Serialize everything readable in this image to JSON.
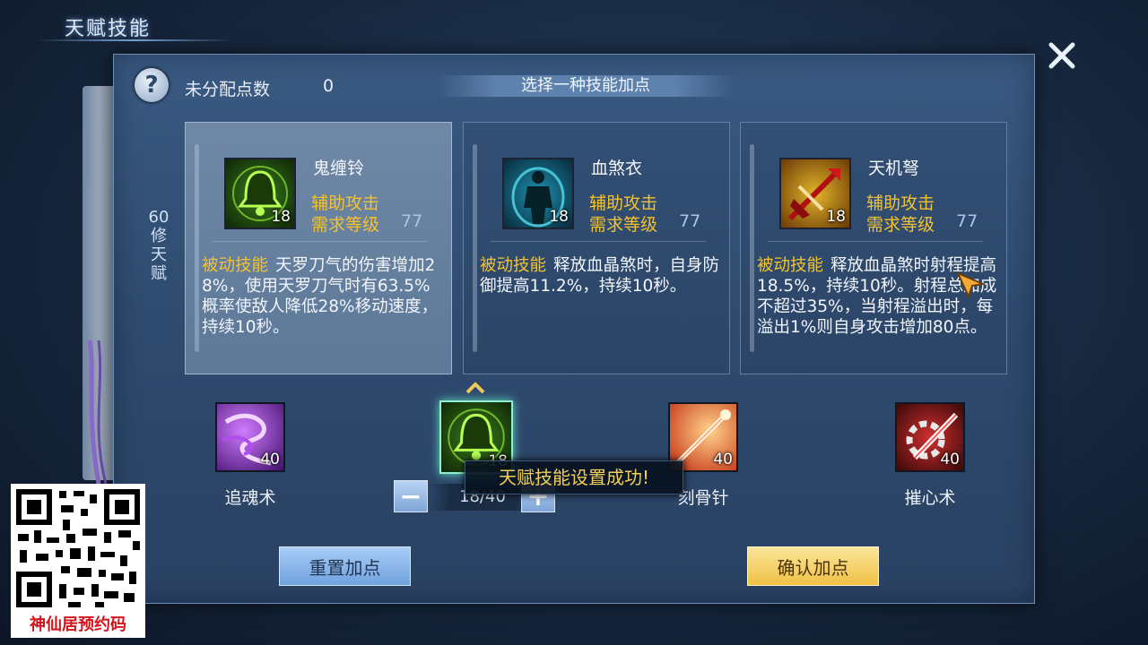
{
  "header": {
    "title": "天赋技能"
  },
  "panel": {
    "unassigned_label": "未分配点数",
    "unassigned_value": "0",
    "choose_banner": "选择一种技能加点",
    "side_label": "60修天赋"
  },
  "cards": [
    {
      "name": "鬼缠铃",
      "type": "辅助攻击",
      "req_label": "需求等级",
      "req_value": "77",
      "level": "18",
      "passive_label": "被动技能",
      "desc": "天罗刀气的伤害增加28%，使用天罗刀气时有63.5%概率使敌人降低28%移动速度，持续10秒。",
      "icon": "bell-icon",
      "selected": true
    },
    {
      "name": "血煞衣",
      "type": "辅助攻击",
      "req_label": "需求等级",
      "req_value": "77",
      "level": "18",
      "passive_label": "被动技能",
      "desc": "释放血晶煞时，自身防御提高11.2%，持续10秒。",
      "icon": "aura-figure-icon",
      "selected": false
    },
    {
      "name": "天机弩",
      "type": "辅助攻击",
      "req_label": "需求等级",
      "req_value": "77",
      "level": "18",
      "passive_label": "被动技能",
      "desc": "释放血晶煞时射程提高18.5%，持续10秒。射程总加成不超过35%，当射程溢出时，每溢出1%则自身攻击增加80点。",
      "icon": "crossbow-icon",
      "selected": false
    }
  ],
  "skills": [
    {
      "name": "追魂术",
      "level": "40",
      "icon": "purple-vortex-icon"
    },
    {
      "name": "",
      "level": "18",
      "icon": "bell-icon"
    },
    {
      "name": "刻骨针",
      "level": "40",
      "icon": "needle-icon"
    },
    {
      "name": "摧心术",
      "level": "40",
      "icon": "gear-blade-icon"
    }
  ],
  "stepper": {
    "minus": "−",
    "plus": "+",
    "value": "18/40"
  },
  "toast": "天赋技能设置成功!",
  "buttons": {
    "reset": "重置加点",
    "confirm": "确认加点"
  },
  "overlay": {
    "qr_caption": "神仙居预约码"
  }
}
